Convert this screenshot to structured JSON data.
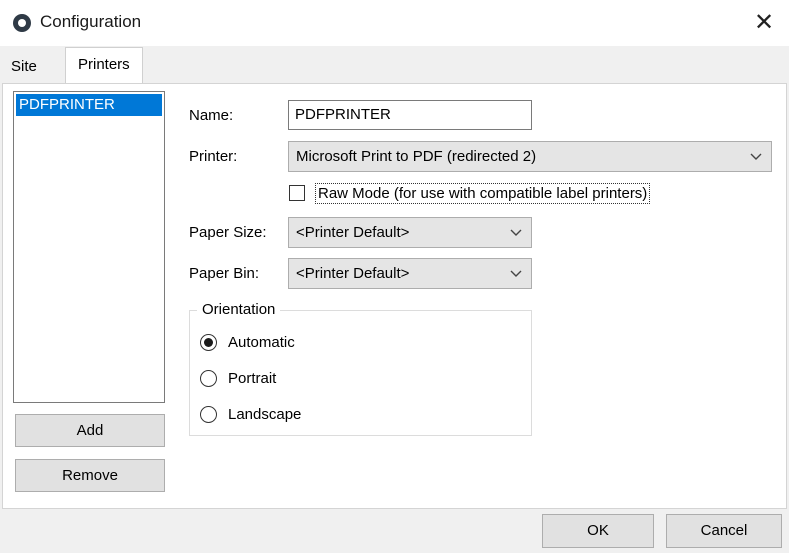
{
  "window": {
    "title": "Configuration",
    "icon": "app-logo-icon",
    "close_icon": "close-icon"
  },
  "tabs": [
    {
      "label": "Site",
      "active": false
    },
    {
      "label": "Printers",
      "active": true
    }
  ],
  "printer_list": {
    "items": [
      "PDFPRINTER"
    ],
    "selected": "PDFPRINTER"
  },
  "list_buttons": {
    "add": "Add",
    "remove": "Remove"
  },
  "form": {
    "name_label": "Name:",
    "name_value": "PDFPRINTER",
    "printer_label": "Printer:",
    "printer_value": "Microsoft Print to PDF (redirected 2)",
    "raw_mode_label": "Raw Mode (for use with compatible label printers)",
    "raw_mode_checked": false,
    "paper_size_label": "Paper Size:",
    "paper_size_value": "<Printer Default>",
    "paper_bin_label": "Paper Bin:",
    "paper_bin_value": "<Printer Default>"
  },
  "orientation": {
    "legend": "Orientation",
    "options": [
      {
        "label": "Automatic",
        "checked": true
      },
      {
        "label": "Portrait",
        "checked": false
      },
      {
        "label": "Landscape",
        "checked": false
      }
    ]
  },
  "footer": {
    "ok": "OK",
    "cancel": "Cancel"
  },
  "colors": {
    "selection": "#0078d7",
    "button_face": "#e1e1e1",
    "window_bg": "#f0f0f0"
  }
}
